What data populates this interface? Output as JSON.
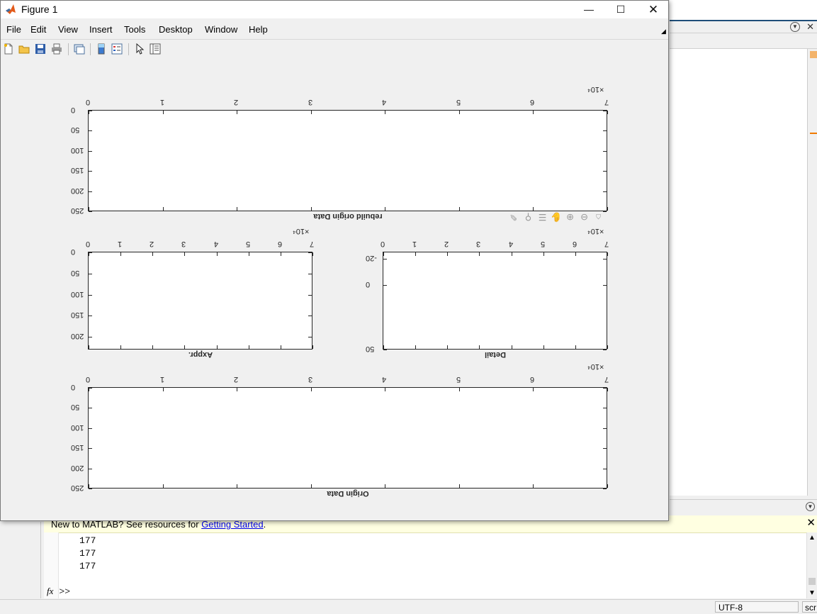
{
  "figure": {
    "title": "Figure 1",
    "menu": [
      "File",
      "Edit",
      "View",
      "Insert",
      "Tools",
      "Desktop",
      "Window",
      "Help"
    ],
    "toolbar_icons": [
      "new-figure-icon",
      "open-file-icon",
      "save-icon",
      "print-icon",
      "link-plot-icon",
      "insert-colorbar-icon",
      "insert-legend-icon",
      "edit-plot-arrow-icon",
      "property-inspector-icon"
    ],
    "axes_toolbar_icons": [
      "data-cursor-icon",
      "brush-icon",
      "export-icon",
      "pan-icon",
      "zoom-in-icon",
      "zoom-out-icon",
      "restore-view-icon"
    ]
  },
  "chart_data": [
    {
      "type": "line",
      "title": "",
      "xlabel": "rebuild origin Data",
      "ylabel": "",
      "xlim": [
        0,
        70000
      ],
      "ylim": [
        0,
        250
      ],
      "xticks": [
        "0",
        "1",
        "2",
        "3",
        "4",
        "5",
        "6",
        "7"
      ],
      "yticks": [
        "0",
        "50",
        "100",
        "150",
        "200",
        "250"
      ],
      "x_exponent": "×10⁴",
      "series": [],
      "grid": false,
      "orientation": "rotated 180 degrees"
    },
    {
      "type": "line",
      "title": "",
      "xlabel": "Axppr.",
      "ylabel": "",
      "xlim": [
        0,
        70000
      ],
      "ylim": [
        0,
        230
      ],
      "xticks": [
        "0",
        "1",
        "2",
        "3",
        "4",
        "5",
        "6",
        "7"
      ],
      "yticks": [
        "0",
        "50",
        "100",
        "150",
        "200"
      ],
      "x_exponent": "×10⁴",
      "series": [],
      "grid": false,
      "orientation": "rotated 180 degrees"
    },
    {
      "type": "line",
      "title": "",
      "xlabel": "Detail",
      "ylabel": "",
      "xlim": [
        0,
        70000
      ],
      "ylim": [
        -25,
        50
      ],
      "xticks": [
        "0",
        "1",
        "2",
        "3",
        "4",
        "5",
        "6",
        "7"
      ],
      "yticks": [
        "-20",
        "0",
        "50"
      ],
      "x_exponent": "×10⁴",
      "series": [],
      "grid": false,
      "orientation": "rotated 180 degrees"
    },
    {
      "type": "line",
      "title": "",
      "xlabel": "Origin Data",
      "ylabel": "",
      "xlim": [
        0,
        70000
      ],
      "ylim": [
        0,
        250
      ],
      "xticks": [
        "0",
        "1",
        "2",
        "3",
        "4",
        "5",
        "6",
        "7"
      ],
      "yticks": [
        "0",
        "50",
        "100",
        "150",
        "200",
        "250"
      ],
      "x_exponent": "×10⁴",
      "series": [],
      "grid": false,
      "orientation": "rotated 180 degrees"
    }
  ],
  "command_window": {
    "banner_prefix": "New to MATLAB? See resources for ",
    "banner_link": "Getting Started",
    "banner_suffix": ".",
    "lines": [
      "177",
      "177",
      "177"
    ],
    "prompt_fx": "fx",
    "prompt": ">>"
  },
  "status_bar": {
    "encoding": "UTF-8",
    "right_cut": "scr"
  },
  "colors": {
    "axes_color": "#262626",
    "figure_bg": "#f0f0f0",
    "banner_bg": "#ffffe1",
    "link": "#0000ee"
  }
}
